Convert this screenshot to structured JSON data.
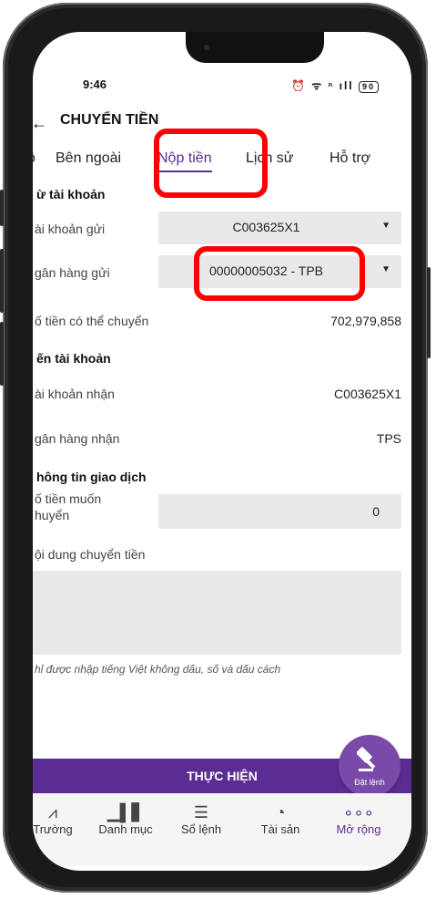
{
  "status": {
    "time": "9:46",
    "icons": "⏰ ᯤ ⁿ ıll",
    "battery": "90"
  },
  "header": {
    "title": "CHUYỂN TIỀN"
  },
  "tabs": [
    "ộ",
    "Bên ngoài",
    "Nộp tiền",
    "Lịch sử",
    "Hỗ trợ"
  ],
  "from": {
    "section": "ừ tài khoản",
    "account_label": "ài khoản gửi",
    "account_value": "C003625X1",
    "bank_label": "gân hàng gửi",
    "bank_value": "00000005032 - TPB",
    "available_label": "ố tiền có thể chuyển",
    "available_value": "702,979,858"
  },
  "to": {
    "section": "ến tài khoản",
    "account_label": "ài khoản nhận",
    "account_value": "C003625X1",
    "bank_label": "gân hàng nhận",
    "bank_value": "TPS"
  },
  "transaction": {
    "section": "hông tin giao dịch",
    "amount_label_1": "ố tiền muốn",
    "amount_label_2": "huyển",
    "amount_value": "0",
    "content_label": "ội dung chuyển tiền",
    "hint": "hỉ được nhập tiếng Việt không dấu, số và dấu cách"
  },
  "submit_label": "THỰC HIỆN",
  "fab_label": "Đặt lệnh",
  "nav": [
    {
      "label": "Trường",
      "icon": "market-pulse-icon"
    },
    {
      "label": "Danh mục",
      "icon": "bar-chart-icon"
    },
    {
      "label": "Sổ lệnh",
      "icon": "list-icon"
    },
    {
      "label": "Tài sản",
      "icon": "pie-icon"
    },
    {
      "label": "Mở rộng",
      "icon": "more-icon"
    }
  ],
  "colors": {
    "accent": "#5b2c91",
    "highlight": "#ff0000",
    "field_bg": "#e9e9ea"
  }
}
